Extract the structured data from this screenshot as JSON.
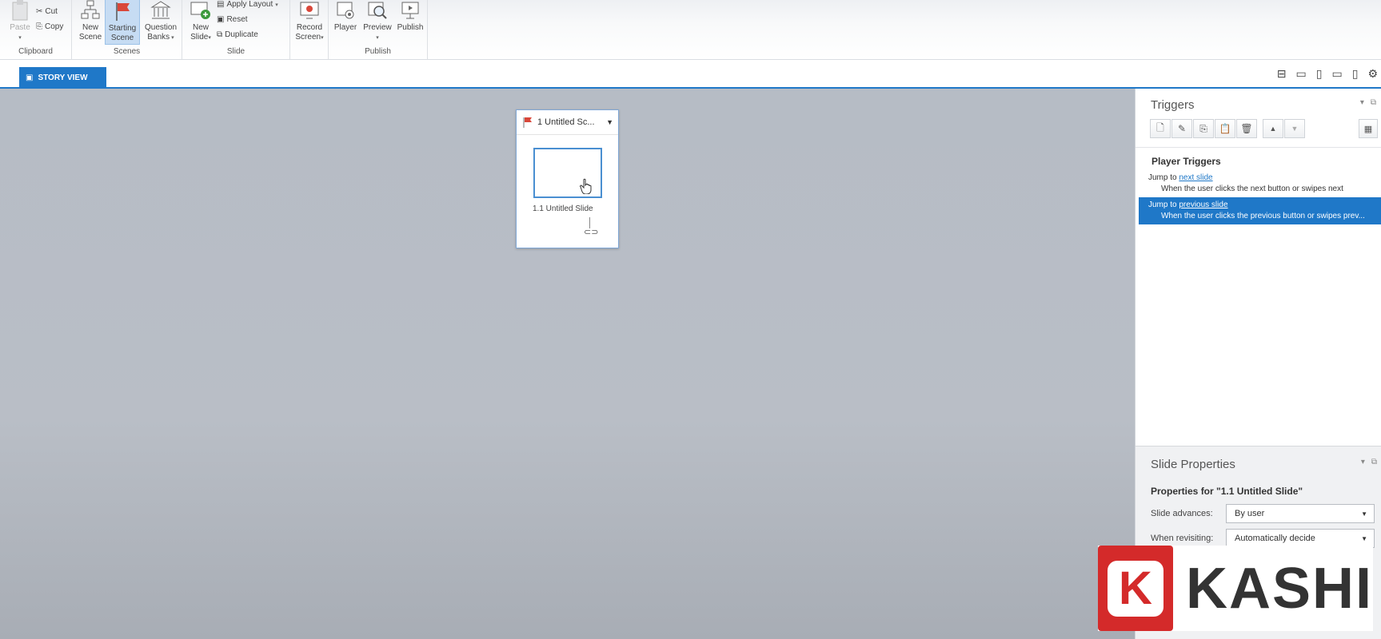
{
  "ribbon": {
    "clipboard": {
      "paste": "Paste",
      "cut": "Cut",
      "copy": "Copy",
      "label": "Clipboard"
    },
    "scenes": {
      "new_scene_1": "New",
      "new_scene_2": "Scene",
      "starting_scene_1": "Starting",
      "starting_scene_2": "Scene",
      "question_banks_1": "Question",
      "question_banks_2": "Banks",
      "label": "Scenes"
    },
    "slide": {
      "new_slide_1": "New",
      "new_slide_2": "Slide",
      "apply_layout": "Apply Layout",
      "reset": "Reset",
      "duplicate": "Duplicate",
      "label": "Slide"
    },
    "record": {
      "line1": "Record",
      "line2": "Screen"
    },
    "publish": {
      "player": "Player",
      "preview": "Preview",
      "publish": "Publish",
      "label": "Publish"
    }
  },
  "tabs": {
    "story_view": "STORY VIEW"
  },
  "scene": {
    "title": "1 Untitled Sc...",
    "slide_label": "1.1 Untitled Slide"
  },
  "triggers": {
    "title": "Triggers",
    "heading": "Player Triggers",
    "items": [
      {
        "prefix": "Jump to ",
        "link": "next slide",
        "condition": "When the user clicks the next button or swipes next"
      },
      {
        "prefix": "Jump to ",
        "link": "previous slide",
        "condition": "When the user clicks the previous button or swipes prev..."
      }
    ]
  },
  "slide_properties": {
    "title": "Slide Properties",
    "heading": "Properties for \"1.1 Untitled Slide\"",
    "advances_label": "Slide advances:",
    "advances_value": "By user",
    "revisiting_label": "When revisiting:",
    "revisiting_value": "Automatically decide"
  },
  "logo": {
    "letter": "K",
    "text": "KASHI"
  },
  "colors": {
    "accent": "#1f78c8",
    "logo_red": "#d42a2a",
    "flag_red": "#d9473a"
  }
}
